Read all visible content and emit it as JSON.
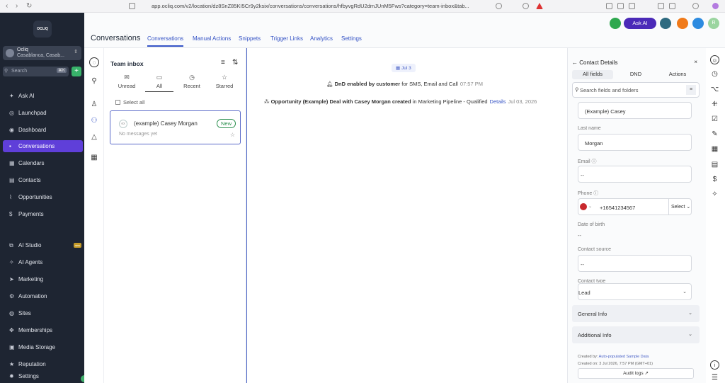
{
  "browser": {
    "url": "app.ocliq.com/v2/location/dz8SnZ85KI5Cr9y2ksix/conversations/conversations/hfbyvgRdU2dmJUnM5Fws?category=team-inbox&tab..."
  },
  "sidebar": {
    "logo_text": "OCLIQ",
    "location_name": "Ocliq",
    "location_sub": "Casablanca, Casab...",
    "search_placeholder": "Search",
    "search_shortcut": "⌘K",
    "items": [
      {
        "label": "Ask AI",
        "icon": "sparkle-icon"
      },
      {
        "label": "Launchpad",
        "icon": "rocket-icon"
      },
      {
        "label": "Dashboard",
        "icon": "gauge-icon"
      },
      {
        "label": "Conversations",
        "icon": "chat-icon",
        "active": true
      },
      {
        "label": "Calendars",
        "icon": "calendar-icon"
      },
      {
        "label": "Contacts",
        "icon": "contacts-icon"
      },
      {
        "label": "Opportunities",
        "icon": "chart-icon"
      },
      {
        "label": "Payments",
        "icon": "dollar-icon"
      },
      {
        "label": "AI Studio",
        "icon": "studio-icon",
        "badge": "new"
      },
      {
        "label": "AI Agents",
        "icon": "agents-icon"
      },
      {
        "label": "Marketing",
        "icon": "send-icon"
      },
      {
        "label": "Automation",
        "icon": "automation-icon"
      },
      {
        "label": "Sites",
        "icon": "globe-icon"
      },
      {
        "label": "Memberships",
        "icon": "members-icon"
      },
      {
        "label": "Media Storage",
        "icon": "media-icon"
      },
      {
        "label": "Reputation",
        "icon": "star-icon"
      },
      {
        "label": "Settings",
        "icon": "gear-icon"
      }
    ]
  },
  "header": {
    "title": "Conversations",
    "tabs": [
      "Conversations",
      "Manual Actions",
      "Snippets",
      "Trigger Links",
      "Analytics",
      "Settings"
    ],
    "ask_ai": "Ask AI",
    "avatar_initial": "R"
  },
  "inbox": {
    "title": "Team inbox",
    "filters": [
      {
        "label": "Unread",
        "glyph": "✉"
      },
      {
        "label": "All",
        "glyph": "▭"
      },
      {
        "label": "Recent",
        "glyph": "◷"
      },
      {
        "label": "Starred",
        "glyph": "☆"
      }
    ],
    "select_all": "Select all",
    "conversation": {
      "name": "(example) Casey Morgan",
      "badge": "New",
      "preview": "No messages yet"
    }
  },
  "thread": {
    "date": "Jul 3",
    "dnd_bold": "DnD enabled by customer",
    "dnd_rest": "for SMS, Email and Call",
    "dnd_time": "07:57 PM",
    "opp_bold": "Opportunity (Example) Deal with Casey Morgan created",
    "opp_rest": "in Marketing Pipeline - Qualified",
    "opp_link": "Details",
    "opp_time": "Jul 03, 2026"
  },
  "details": {
    "title": "Contact Details",
    "tabs": [
      "All fields",
      "DND",
      "Actions"
    ],
    "search_placeholder": "Search fields and folders",
    "first_name_value": "(Example) Casey",
    "last_name_label": "Last name",
    "last_name_value": "Morgan",
    "email_label": "Email",
    "email_value": "--",
    "phone_label": "Phone",
    "phone_value": "+16541234567",
    "phone_type": "Select",
    "dob_label": "Date of birth",
    "dob_value": "--",
    "source_label": "Contact source",
    "source_value": "--",
    "type_label": "Contact type",
    "type_value": "Lead",
    "accordions": [
      "General Info",
      "Additional Info"
    ],
    "created_by_prefix": "Created by:",
    "created_by_value": "Auto-populated Sample Data",
    "created_on": "Created on: 3 Jul 2026, 7:57 PM (GMT+01)",
    "audit": "Audit logs"
  }
}
